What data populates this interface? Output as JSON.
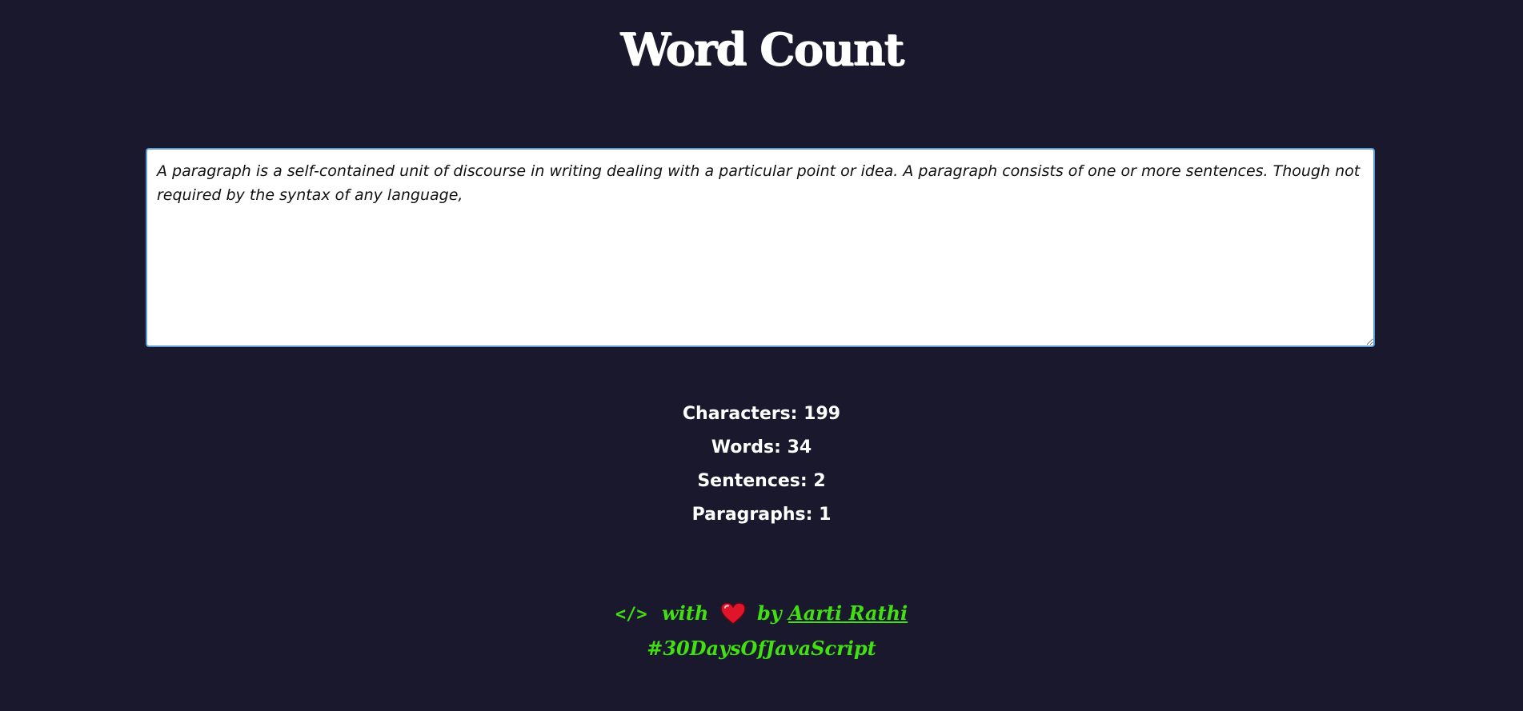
{
  "header": {
    "title": "Word Count"
  },
  "editor": {
    "value": "A paragraph is a self-contained unit of discourse in writing dealing with a particular point or idea. A paragraph consists of one or more sentences. Though not required by the syntax of any language,"
  },
  "stats": [
    {
      "label": "Characters:",
      "value": "199"
    },
    {
      "label": "Words:",
      "value": "34"
    },
    {
      "label": "Sentences:",
      "value": "2"
    },
    {
      "label": "Paragraphs:",
      "value": "1"
    }
  ],
  "footer": {
    "code_glyph": "</>",
    "with_text": "with",
    "by_text": "by",
    "author": "Aarti Rathi",
    "hashtag": "#30DaysOfJavaScript",
    "icons": [
      "code-icon",
      "heart-icon"
    ],
    "accent_color": "#40e012",
    "heart_color": "#e0142b"
  },
  "colors": {
    "background": "#1a182d",
    "text": "#ffffff",
    "editor_border": "#5b9bd5"
  }
}
